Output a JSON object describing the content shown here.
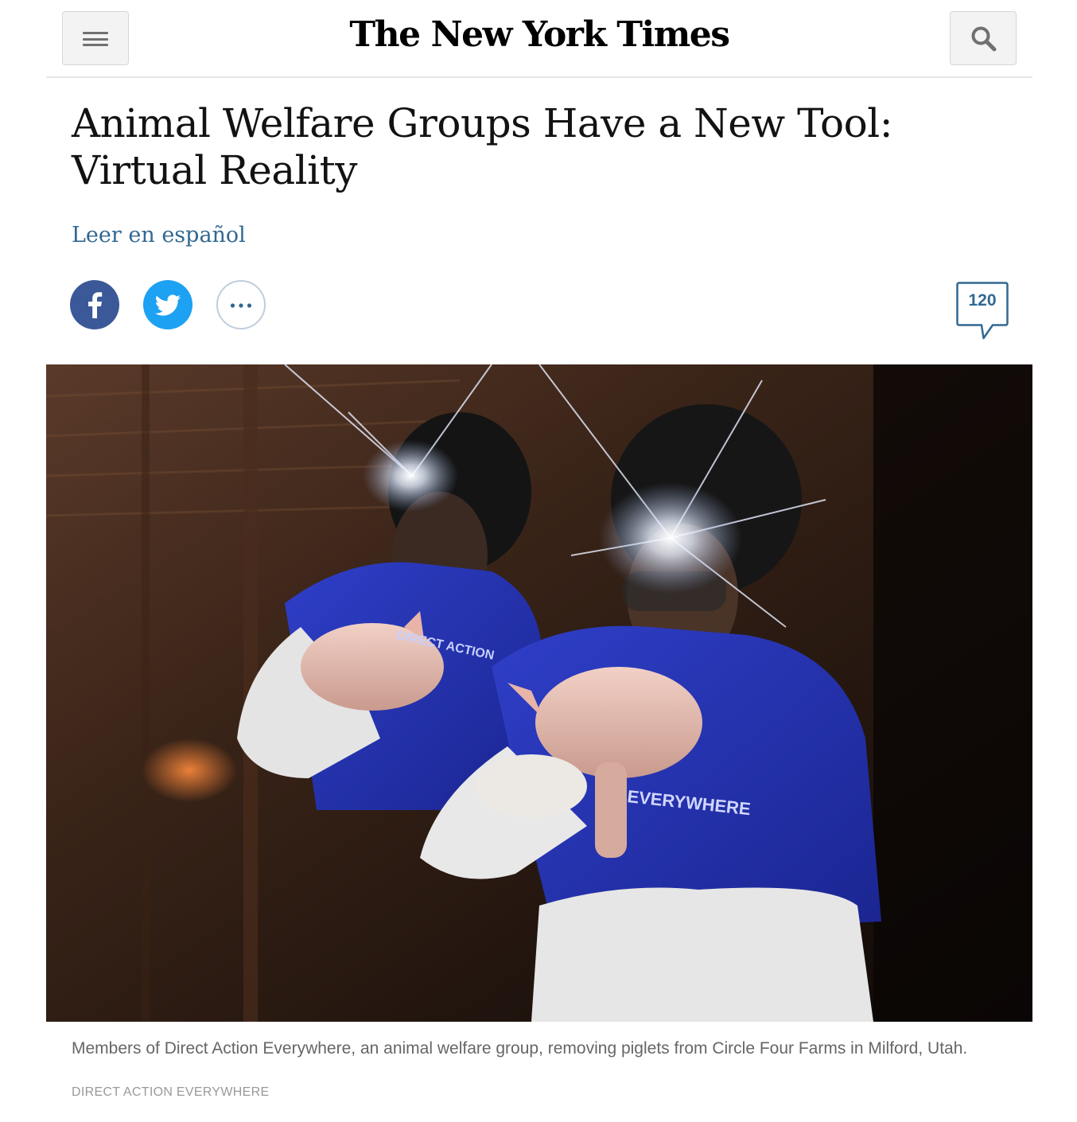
{
  "header": {
    "logo_text": "The New York Times",
    "menu_icon": "hamburger-menu-icon",
    "search_icon": "search-icon"
  },
  "article": {
    "headline": "Animal Welfare Groups Have a New Tool: Virtual Reality",
    "language_link": "Leer en español"
  },
  "share": {
    "facebook_icon": "facebook-icon",
    "twitter_icon": "twitter-icon",
    "more_icon": "more-options-icon",
    "comment_count": "120"
  },
  "photo": {
    "shirt_text_1": "DIRECT ACTION",
    "shirt_text_2": "EVERYWHERE"
  },
  "caption": {
    "text": "Members of Direct Action Everywhere, an animal welfare group, removing piglets from Circle Four Farms in Milford, Utah.",
    "credit": "DIRECT ACTION EVERYWHERE"
  },
  "colors": {
    "link": "#326891",
    "facebook": "#3b5998",
    "twitter": "#1da1f2"
  }
}
